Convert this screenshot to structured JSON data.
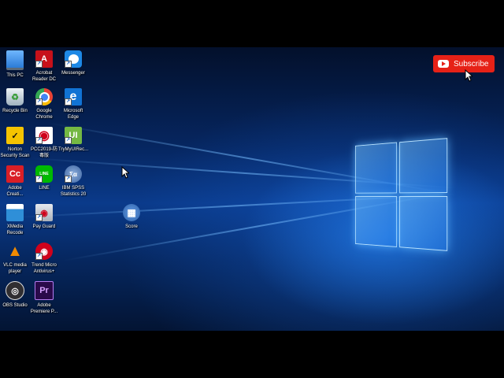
{
  "desktop": {
    "icons": [
      {
        "id": "this-pc",
        "label": "This PC",
        "icon": "computer-icon",
        "color": "#2b7bd6",
        "glyph": ""
      },
      {
        "id": "acrobat",
        "label": "Acrobat\nReader DC",
        "icon": "acrobat-icon",
        "color": "#c7111a",
        "glyph": "A"
      },
      {
        "id": "messenger",
        "label": "Messenger",
        "icon": "messenger-icon",
        "color": "#1e88e5",
        "glyph": "~"
      },
      {
        "id": "recycle-bin",
        "label": "Recycle Bin",
        "icon": "recycle-bin-icon",
        "color": "#cfd8dc",
        "glyph": ""
      },
      {
        "id": "chrome",
        "label": "Google\nChrome",
        "icon": "chrome-icon",
        "color": "#34a853",
        "glyph": "●"
      },
      {
        "id": "edge",
        "label": "Microsoft\nEdge",
        "icon": "edge-icon",
        "color": "#1173d4",
        "glyph": "e"
      },
      {
        "id": "norton",
        "label": "Norton\nSecurity Scan",
        "icon": "norton-icon",
        "color": "#f5c400",
        "glyph": "✓"
      },
      {
        "id": "pcc2019",
        "label": "PCC2019-防\n毒版",
        "icon": "trend-micro-icon",
        "color": "#d0021b",
        "glyph": "◉"
      },
      {
        "id": "trymyui",
        "label": "TryMyUIRec...",
        "icon": "trymyui-icon",
        "color": "#74b843",
        "glyph": "UI"
      },
      {
        "id": "adobe-creative",
        "label": "Adobe\nCreati...",
        "icon": "adobe-cc-icon",
        "color": "#da1f26",
        "glyph": "Cc"
      },
      {
        "id": "line",
        "label": "LINE",
        "icon": "line-icon",
        "color": "#00b900",
        "glyph": "LINE"
      },
      {
        "id": "spss",
        "label": "IBM SPSS\nStatistics 20",
        "icon": "spss-icon",
        "color": "#5b7fb5",
        "glyph": "Σα"
      },
      {
        "id": "xmedia",
        "label": "XMedia\nRecode",
        "icon": "xmedia-recode-icon",
        "color": "#2f8fd8",
        "glyph": "▮"
      },
      {
        "id": "payguard",
        "label": "Pay Guard",
        "icon": "pay-guard-icon",
        "color": "#c9ccd1",
        "glyph": "◉"
      },
      {
        "id": "score",
        "label": "Score",
        "icon": "score-icon",
        "color": "#3b78c9",
        "glyph": "▦"
      },
      {
        "id": "vlc",
        "label": "VLC media\nplayer",
        "icon": "vlc-icon",
        "color": "#f08a00",
        "glyph": "▲"
      },
      {
        "id": "trend-antivirus",
        "label": "Trend Micro\nAntivirus+",
        "icon": "trend-micro-antivirus-icon",
        "color": "#d0021b",
        "glyph": "◉"
      },
      {
        "id": "obs",
        "label": "OBS Studio",
        "icon": "obs-icon",
        "color": "#302e31",
        "glyph": "◎"
      },
      {
        "id": "premiere",
        "label": "Adobe\nPremiere P...",
        "icon": "premiere-icon",
        "color": "#2a0a4a",
        "glyph": "Pr"
      }
    ]
  },
  "overlay": {
    "subscribe_label": "Subscribe",
    "subscribe_color": "#e62117"
  }
}
